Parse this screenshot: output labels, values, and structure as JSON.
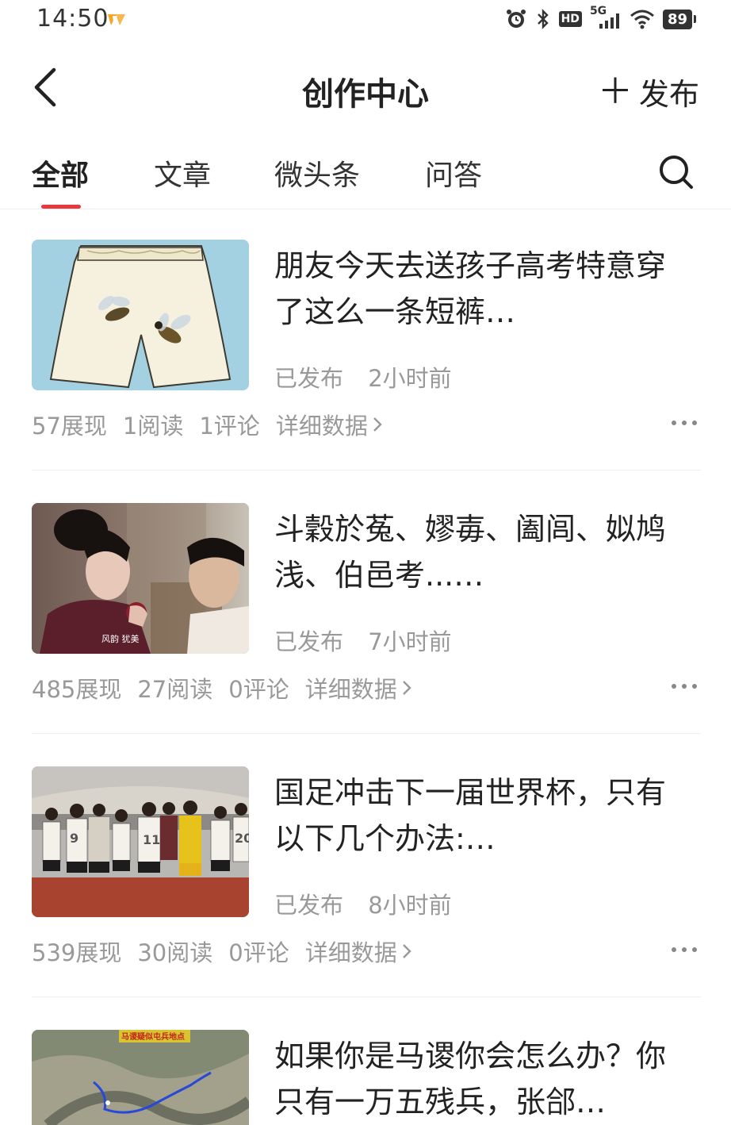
{
  "status_bar": {
    "time": "14:50",
    "network": "5G",
    "hd": "HD",
    "battery": "89"
  },
  "header": {
    "title": "创作中心",
    "publish_label": "发布"
  },
  "tabs": [
    {
      "label": "全部",
      "active": true
    },
    {
      "label": "文章",
      "active": false
    },
    {
      "label": "微头条",
      "active": false
    },
    {
      "label": "问答",
      "active": false
    }
  ],
  "accent_color": "#e8383c",
  "articles": [
    {
      "title": "朋友今天去送孩子高考特意穿了这么一条短裤…",
      "status": "已发布",
      "time": "2小时前",
      "impressions": "57展现",
      "reads": "1阅读",
      "comments": "1评论",
      "detail_label": "详细数据"
    },
    {
      "title": "斗穀於菟、嫪毐、阖闾、姒鸠浅、伯邑考...…",
      "status": "已发布",
      "time": "7小时前",
      "impressions": "485展现",
      "reads": "27阅读",
      "comments": "0评论",
      "detail_label": "详细数据",
      "thumb_caption": "风韵 犹美"
    },
    {
      "title": "国足冲击下一届世界杯，只有以下几个办法:…",
      "status": "已发布",
      "time": "8小时前",
      "impressions": "539展现",
      "reads": "30阅读",
      "comments": "0评论",
      "detail_label": "详细数据"
    },
    {
      "title": "如果你是马谡你会怎么办？你只有一万五残兵，张郃…",
      "thumb_caption": "马谡疑似屯兵地点"
    }
  ]
}
